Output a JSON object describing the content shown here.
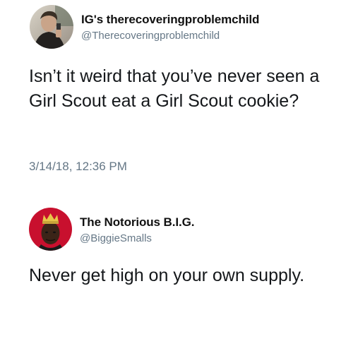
{
  "tweets": [
    {
      "display_name": "IG's therecoveringproblemchild",
      "handle": "@Therecoveringproblemchild",
      "text": "Isn’t it weird that you’ve never seen a Girl Scout eat a Girl Scout cookie?",
      "timestamp": "3/14/18, 12:36 PM",
      "avatar": "profile-photo"
    },
    {
      "display_name": "The Notorious B.I.G.",
      "handle": "@BiggieSmalls",
      "text": "Never get high on your own supply.",
      "avatar": "profile-photo-red-background-crown"
    }
  ],
  "colors": {
    "text_primary": "#14171a",
    "text_secondary": "#657786",
    "background": "#ffffff",
    "avatar2_background": "#c8102e"
  }
}
